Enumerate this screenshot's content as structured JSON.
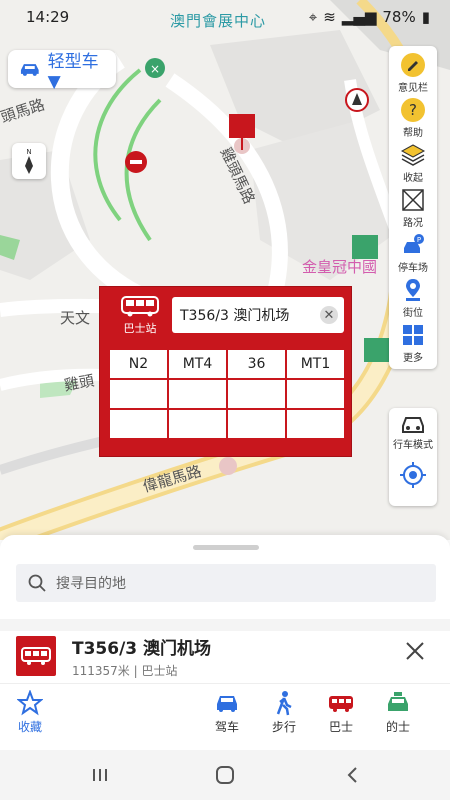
{
  "status": {
    "time": "14:29",
    "battery": "78%"
  },
  "map": {
    "labels": {
      "macau_center": "澳門會展中心",
      "road_1": "頭馬路",
      "road_2": "雞頭馬路",
      "road_3": "天文",
      "road_4": "雞頭",
      "road_5": "偉龍馬路",
      "poi_1": "金皇冠中國"
    },
    "compass_letter": "N"
  },
  "vehicle": {
    "label": "轻型车 ▼"
  },
  "toolbar": {
    "items": [
      {
        "label": "意见栏",
        "icon": "edit-icon"
      },
      {
        "label": "帮助",
        "icon": "help-icon"
      },
      {
        "label": "收起",
        "icon": "layers-icon"
      },
      {
        "label": "路况",
        "icon": "traffic-icon"
      },
      {
        "label": "停车场",
        "icon": "parking-icon"
      },
      {
        "label": "街位",
        "icon": "street-parking-icon"
      },
      {
        "label": "更多",
        "icon": "more-icon"
      }
    ],
    "drive_mode": "行车模式"
  },
  "popup": {
    "badge": "巴士站",
    "title": "T356/3 澳门机场",
    "routes": [
      "N2",
      "MT4",
      "36",
      "MT1",
      "",
      "",
      "",
      "",
      "",
      "",
      "",
      ""
    ]
  },
  "sheet": {
    "search_placeholder": "搜寻目的地",
    "place_title": "T356/3 澳门机场",
    "place_sub": "111357米 | 巴士站"
  },
  "nav": {
    "favorites": "收藏",
    "drive": "驾车",
    "walk": "步行",
    "bus": "巴士",
    "taxi": "的士"
  },
  "colors": {
    "accent": "#2f6fe0",
    "bus_red": "#c8161d",
    "map_bg": "#f1f0ed",
    "road_green": "#7fd27f",
    "taxi_green": "#3aa36b"
  }
}
